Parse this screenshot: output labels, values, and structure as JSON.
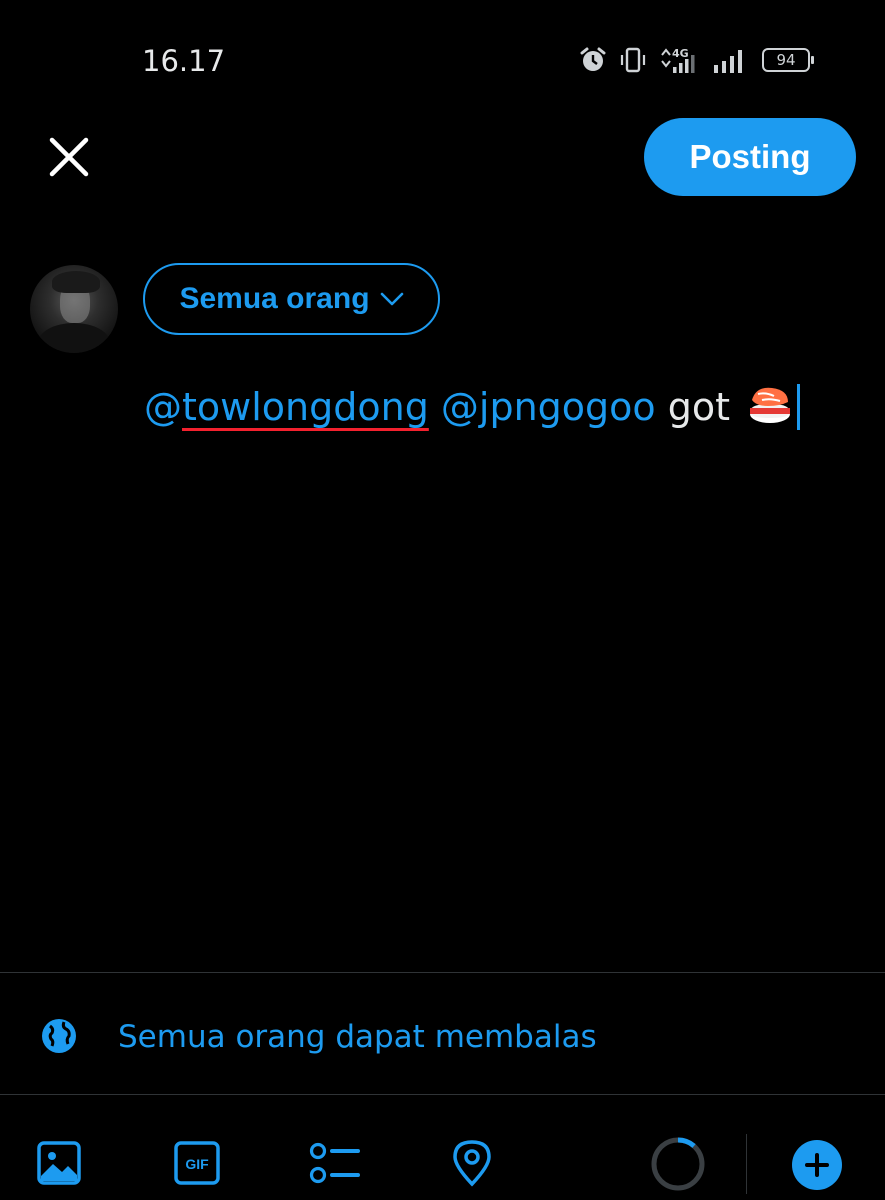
{
  "status_bar": {
    "time": "16.17",
    "network": "4G",
    "battery": "94",
    "icons": [
      "alarm-icon",
      "vibrate-icon",
      "signal-4g-icon",
      "signal-icon",
      "battery-icon"
    ]
  },
  "header": {
    "close_icon": "close-icon",
    "post_label": "Posting"
  },
  "composer": {
    "audience_label": "Semua orang",
    "mention1_at": "@",
    "mention1_name": "towlongdong",
    "mention2": "@jpngogoo",
    "text": "got",
    "emoji": "sushi-emoji"
  },
  "reply_setting": {
    "label": "Semua orang dapat membalas",
    "icon": "globe-icon"
  },
  "toolbar": {
    "items": [
      "image-icon",
      "gif-icon",
      "poll-icon",
      "location-icon",
      "character-count-ring",
      "add-thread-icon"
    ],
    "gif_label": "GIF"
  },
  "colors": {
    "accent": "#1d9bf0",
    "background": "#000000",
    "text": "#e7e9ea",
    "spellcheck": "#f4212e"
  }
}
